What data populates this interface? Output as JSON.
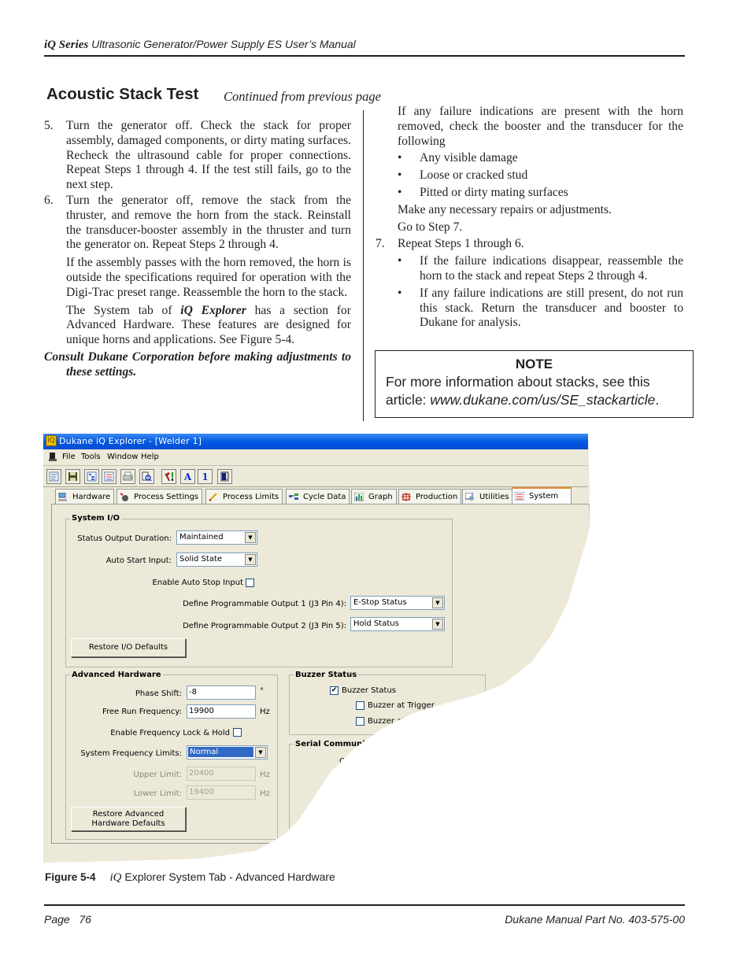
{
  "header": {
    "brand": "iQ Series",
    "title": "Ultrasonic Generator/Power Supply ES User’s Manual"
  },
  "section": {
    "title": "Acoustic Stack Test",
    "continued": "Continued from previous page"
  },
  "left_column": {
    "step5": {
      "num": "5.",
      "text": "Turn the generator off. Check the stack for proper assembly, damaged components, or dirty mating surfaces. Recheck the ultrasound cable for proper connections. Repeat Steps 1 through 4. If the test still fails, go to the next step."
    },
    "step6": {
      "num": "6.",
      "text": "Turn the generator off, remove the stack from the thruster, and remove the horn from the stack. Reinstall the transducer-booster assembly in the thruster and turn the generator on. Repeat Steps 2 through 4."
    },
    "para1": "If the assembly passes with the horn removed, the horn is outside the specifications required for operation with the Digi-Trac preset range. Reassemble the horn to the stack.",
    "para2_pre": "The System tab of ",
    "para2_em": "iQ Explorer",
    "para2_post": " has a section for Advanced Hardware. These features are designed for unique horns and applications. See Figure 5-4.",
    "warning": "Consult Dukane Corporation before making adjustments to these settings."
  },
  "right_column": {
    "intro": "If any failure indications are present with the horn removed, check the booster and the transducer for the following",
    "checks": [
      "Any visible damage",
      "Loose or cracked stud",
      "Pitted or dirty mating surfaces"
    ],
    "repair": "Make any necessary repairs or adjustments.",
    "goto": "Go to Step 7.",
    "step7": {
      "num": "7.",
      "text": "Repeat Steps 1 through 6."
    },
    "step7_bullets": [
      "If the failure indications disappear, reassemble the horn to the stack and repeat Steps 2 through 4.",
      "If any failure indications are still present, do not run this stack. Return the transducer and booster to Dukane for analysis."
    ]
  },
  "note": {
    "title": "NOTE",
    "text_pre": "For more information about stacks, see this article: ",
    "link": "www.dukane.com/us/SE_stackarticle",
    "text_post": "."
  },
  "app": {
    "window_title": "Dukane iQ Explorer - [Welder 1]",
    "menu": [
      "File",
      "Tools",
      "Window",
      "Help"
    ],
    "toolbar_icons": [
      "report-icon",
      "save-icon",
      "tree-icon",
      "list-icon",
      "print-icon",
      "preview-icon",
      "tools-icon",
      "font-a-icon",
      "number-1-icon",
      "exit-icon"
    ],
    "toolbar_text": {
      "a": "A",
      "one": "1"
    },
    "tabs": [
      {
        "label": "Hardware",
        "active": false
      },
      {
        "label": "Process Settings",
        "active": false
      },
      {
        "label": "Process Limits",
        "active": false
      },
      {
        "label": "Cycle Data",
        "active": false
      },
      {
        "label": "Graph",
        "active": false
      },
      {
        "label": "Production",
        "active": false
      },
      {
        "label": "Utilities",
        "active": false
      },
      {
        "label": "System",
        "active": true
      }
    ],
    "system_io": {
      "title": "System I/O",
      "status_output_label": "Status Output Duration:",
      "status_output_value": "Maintained",
      "auto_start_label": "Auto Start Input:",
      "auto_start_value": "Solid State",
      "auto_stop_label": "Enable Auto Stop Input",
      "auto_stop_checked": false,
      "output1_label": "Define Programmable Output 1 (J3 Pin 4):",
      "output1_value": "E-Stop Status",
      "output2_label": "Define Programmable Output 2 (J3 Pin 5):",
      "output2_value": "Hold Status",
      "restore_label": "Restore I/O Defaults"
    },
    "advanced_hardware": {
      "title": "Advanced Hardware",
      "phase_shift_label": "Phase Shift:",
      "phase_shift_value": "-8",
      "phase_shift_unit": "°",
      "free_run_label": "Free Run Frequency:",
      "free_run_value": "19900",
      "free_run_unit": "Hz",
      "freq_lock_label": "Enable Frequency Lock & Hold",
      "freq_lock_checked": false,
      "sys_freq_label": "System Frequency Limits:",
      "sys_freq_value": "Normal",
      "upper_label": "Upper Limit:",
      "upper_value": "20400",
      "upper_unit": "Hz",
      "lower_label": "Lower Limit:",
      "lower_value": "19400",
      "lower_unit": "Hz",
      "restore_label_1": "Restore Advanced",
      "restore_label_2": "Hardware Defaults"
    },
    "buzzer": {
      "title": "Buzzer Status",
      "items": [
        {
          "label": "Buzzer Status",
          "checked": true
        },
        {
          "label": "Buzzer at Trigger",
          "checked": false
        },
        {
          "label": "Buzzer at E",
          "checked": false
        }
      ],
      "check_mark": "✔"
    },
    "serial": {
      "title": "Serial Communicat",
      "partial_label": "Ou"
    }
  },
  "figure": {
    "label": "Figure 5-4",
    "iq": "iQ",
    "caption": " Explorer System Tab - Advanced Hardware"
  },
  "footer": {
    "page": "Page   76",
    "part_no": "Dukane Manual Part No. 403-575-00"
  }
}
